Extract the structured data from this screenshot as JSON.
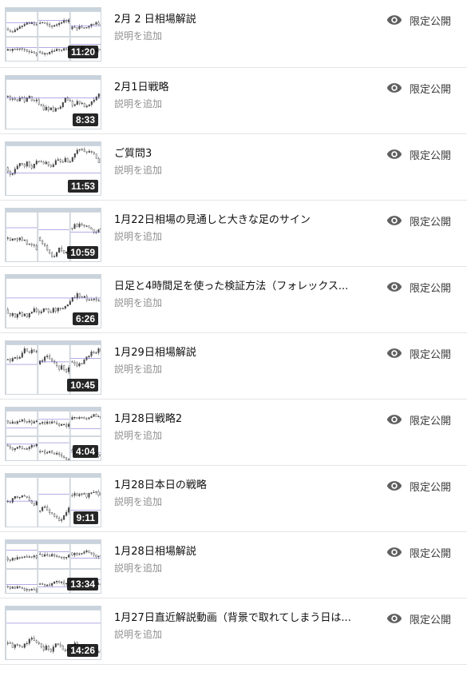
{
  "description_placeholder": "説明を追加",
  "visibility_label": "限定公開",
  "colors": {
    "title": "#0f0f0f",
    "description": "#909090",
    "duration_bg": "#000000",
    "divider": "#e5e5e5"
  },
  "videos": [
    {
      "title": "2月 2 日相場解説",
      "duration": "11:20",
      "icon": "eye-icon"
    },
    {
      "title": "2月1日戦略",
      "duration": "8:33",
      "icon": "eye-icon"
    },
    {
      "title": "ご質問3",
      "duration": "11:53",
      "icon": "eye-icon"
    },
    {
      "title": "1月22日相場の見通しと大きな足のサイン",
      "duration": "10:59",
      "icon": "eye-icon"
    },
    {
      "title": "日足と4時間足を使った検証方法（フォレックス...",
      "duration": "6:26",
      "icon": "eye-icon"
    },
    {
      "title": "1月29日相場解説",
      "duration": "10:45",
      "icon": "eye-icon"
    },
    {
      "title": "1月28日戦略2",
      "duration": "4:04",
      "icon": "eye-icon"
    },
    {
      "title": "1月28日本日の戦略",
      "duration": "9:11",
      "icon": "eye-icon"
    },
    {
      "title": "1月28日相場解説",
      "duration": "13:34",
      "icon": "eye-icon"
    },
    {
      "title": "1月27日直近解説動画（背景で取れてしまう日は...",
      "duration": "14:26",
      "icon": "eye-icon"
    }
  ]
}
